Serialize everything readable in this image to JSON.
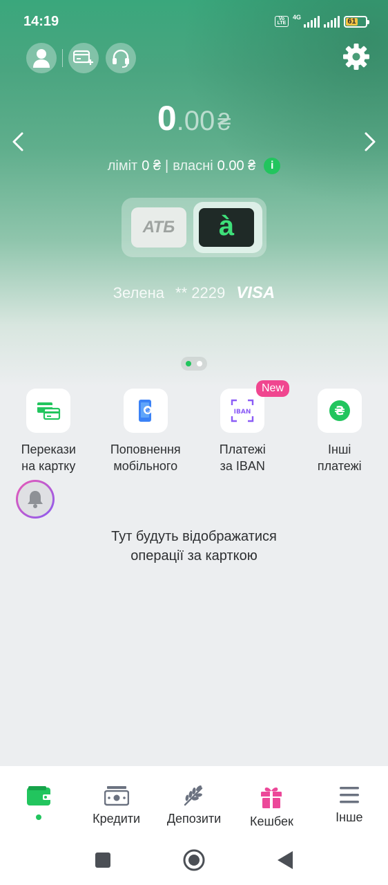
{
  "status": {
    "time": "14:19",
    "volte": "Vo LTE",
    "network": "4G",
    "battery": "61",
    "battery_level": 0.61
  },
  "balance": {
    "integer": "0",
    "decimals": ".00",
    "currency": "₴"
  },
  "limits": {
    "limit_label": "ліміт",
    "limit_value": "0 ₴",
    "separator": "|",
    "own_label": "власні",
    "own_value": "0.00 ₴",
    "info_icon": "i"
  },
  "cards": {
    "atb_logo": "АТБ",
    "a_logo": "à",
    "card_name": "Зелена",
    "card_mask": "** 2229",
    "network_brand": "VISA"
  },
  "pager": {
    "total": 2,
    "active": 1
  },
  "actions": [
    {
      "label": "Перекази\nна картку",
      "icon": "card-transfer-icon"
    },
    {
      "label": "Поповнення\nмобільного",
      "icon": "phone-topup-icon"
    },
    {
      "label": "Платежі\nза IBAN",
      "icon": "iban-icon",
      "badge": "New"
    },
    {
      "label": "Інші\nплатежі",
      "icon": "hryvnia-icon"
    }
  ],
  "empty_state": "Тут будуть відображатися\nоперації за карткою",
  "tabbar": [
    {
      "label": "",
      "icon": "wallet-icon",
      "active": true
    },
    {
      "label": "Кредити",
      "icon": "cash-icon"
    },
    {
      "label": "Депозити",
      "icon": "wheat-icon"
    },
    {
      "label": "Кешбек",
      "icon": "gift-icon"
    },
    {
      "label": "Інше",
      "icon": "menu-icon"
    }
  ],
  "colors": {
    "accent": "#22c55e",
    "badge": "#f0468f",
    "gift": "#ec4899"
  }
}
